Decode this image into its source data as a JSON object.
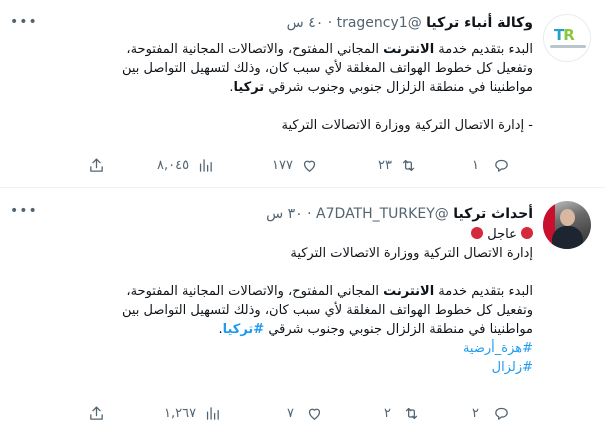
{
  "tweet1": {
    "name": "وكالة أنباء تركيا",
    "handle": "@tragency1",
    "dot": "·",
    "time": "٤٠ س",
    "lines": [
      [
        "البدء بتقديم خدمة ",
        "الانترنت",
        " المجاني المفتوح، والاتصالات المجانية المفتوحة،"
      ],
      [
        "وتفعيل كل خطوط الهواتف المغلقة لأي سبب كان، وذلك لتسهيل التواصل بين"
      ],
      [
        "مواطنينا في منطقة الزلزال جنوبي وجنوب شرقي ",
        "تركيا",
        "."
      ]
    ],
    "signature": "- إدارة الاتصال التركية ووزارة الاتصالات التركية",
    "replies": "١",
    "retweets": "٢٣",
    "likes": "١٧٧",
    "views": "٨,٠٤٥"
  },
  "tweet2": {
    "name": "أحداث تركيا",
    "handle": "@A7DATH_TURKEY",
    "dot": "·",
    "time": "٣٠ س",
    "urgent": "عاجل",
    "intro": "إدارة الاتصال التركية ووزارة الاتصالات التركية",
    "lines": [
      [
        "البدء بتقديم خدمة ",
        "الانترنت",
        " المجاني المفتوح، والاتصالات المجانية المفتوحة،"
      ],
      [
        "وتفعيل كل خطوط الهواتف المغلقة لأي سبب كان، وذلك لتسهيل التواصل بين"
      ],
      [
        "مواطنينا في منطقة الزلزال جنوبي وجنوب شرقي ",
        "#تركيا",
        "."
      ]
    ],
    "hashtags": [
      "#هزة_أرضية",
      "#زلزال"
    ],
    "replies": "٢",
    "retweets": "٢",
    "likes": "٧",
    "views": "١,٢٦٧"
  },
  "icons": {
    "more": "more-icon",
    "reply": "reply-icon",
    "retweet": "retweet-icon",
    "like": "heart-icon",
    "views": "views-icon",
    "share": "share-icon"
  },
  "colors": {
    "link": "#1d9bf0",
    "muted": "#536471",
    "text": "#0f1419",
    "urgent": "#d42a3c"
  }
}
